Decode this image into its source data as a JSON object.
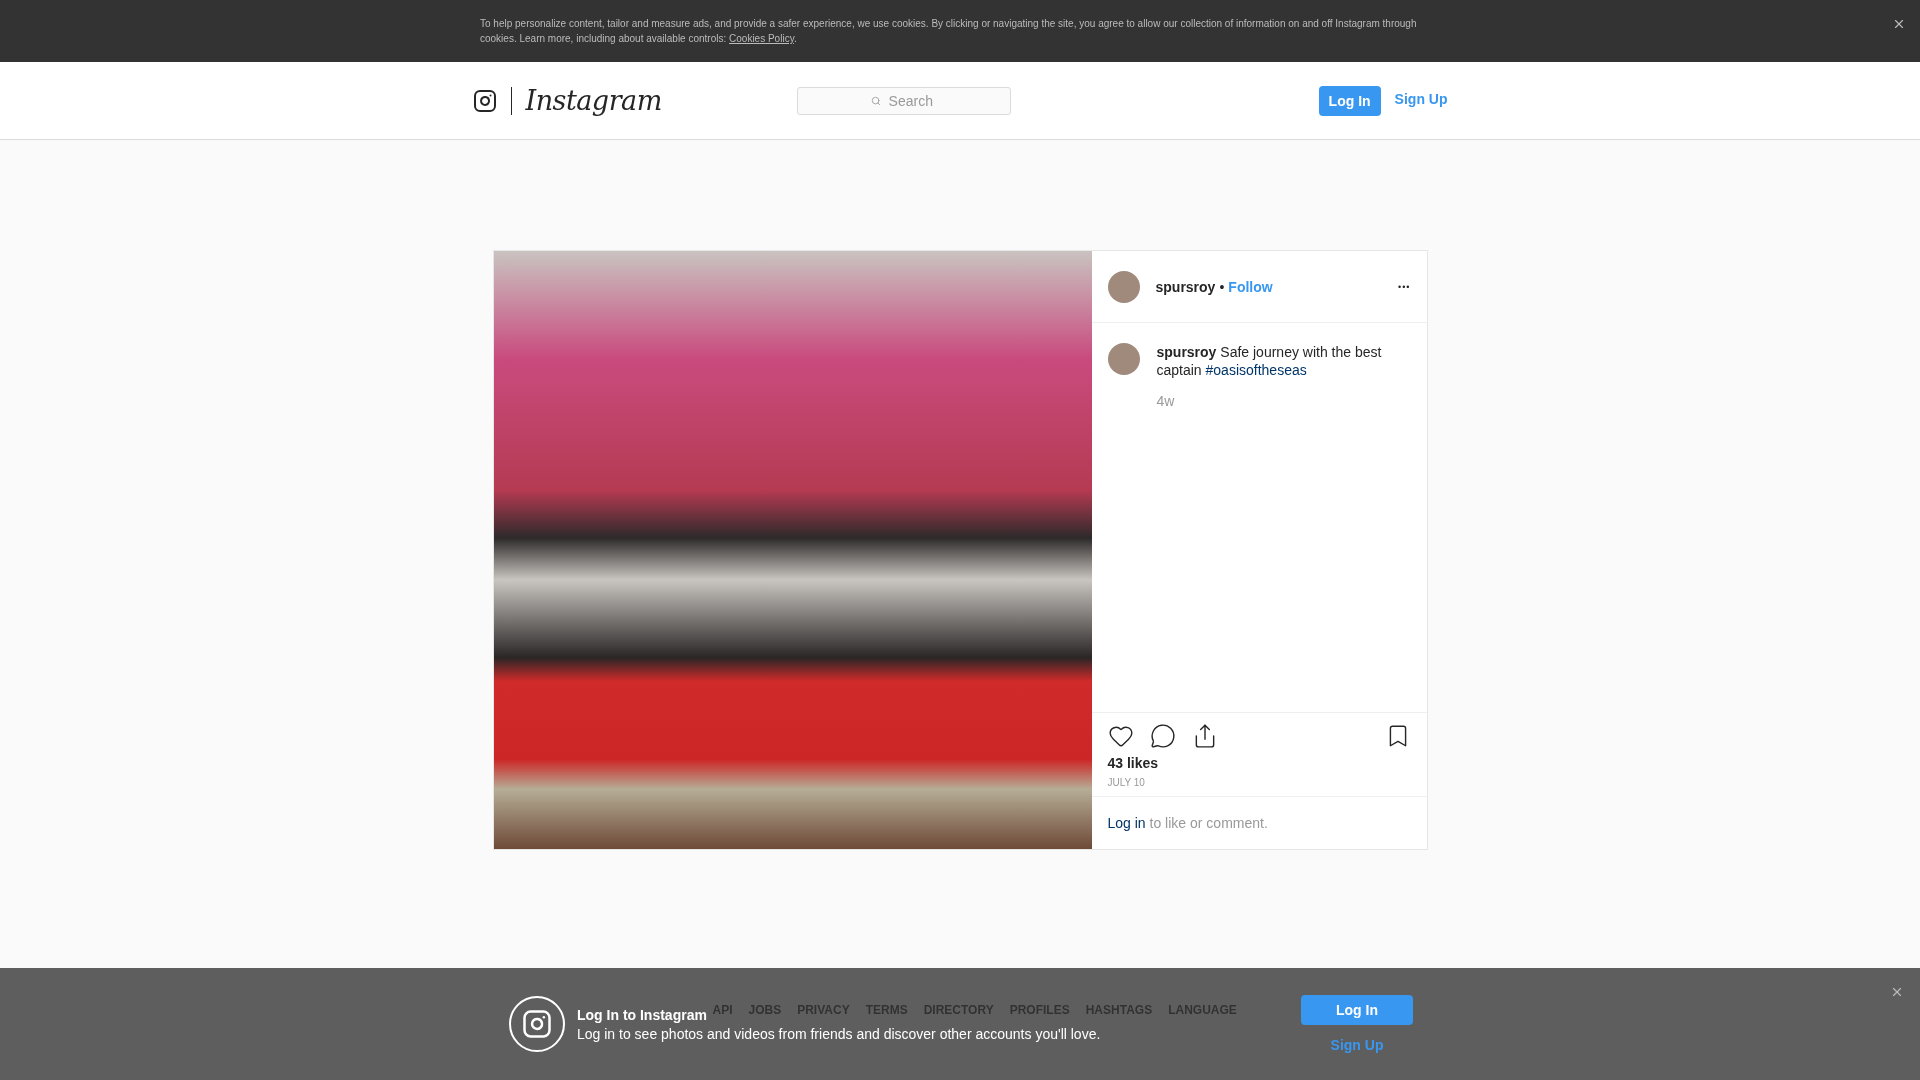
{
  "cookie_banner": {
    "text": "To help personalize content, tailor and measure ads, and provide a safer experience, we use cookies. By clicking or navigating the site, you agree to allow our collection of information on and off Instagram through cookies. Learn more, including about available controls: ",
    "link": "Cookies Policy",
    "end": "."
  },
  "header": {
    "logo": "Instagram",
    "search": {
      "placeholder": "Search"
    },
    "login": "Log In",
    "signup": "Sign Up"
  },
  "post": {
    "username": "spursroy",
    "separator": "•",
    "follow": "Follow",
    "more": "•••",
    "caption": {
      "text": "**spursroy** Safe journey with the best captain ",
      "hashtag": "#oasisoftheseas"
    },
    "age": "4w",
    "likes": "43 likes",
    "date": "JULY 10",
    "comment_prompt": {
      "link": "Log in",
      "text": " to like or comment."
    }
  },
  "footer_links": [
    "API",
    "JOBS",
    "PRIVACY",
    "TERMS",
    "DIRECTORY",
    "PROFILES",
    "HASHTAGS",
    "LANGUAGE"
  ],
  "login_prompt": {
    "title": "Log In to Instagram",
    "text": "Log in to see photos and videos from friends and discover other accounts you'll love.",
    "login": "Log In",
    "signup": "Sign Up"
  }
}
